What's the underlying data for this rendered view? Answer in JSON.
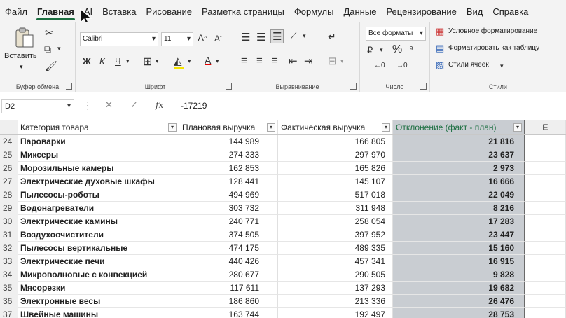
{
  "menu": {
    "tabs": [
      "Файл",
      "Главная",
      "AI",
      "Вставка",
      "Рисование",
      "Разметка страницы",
      "Формулы",
      "Данные",
      "Рецензирование",
      "Вид",
      "Справка"
    ],
    "active": "Главная"
  },
  "ribbon": {
    "clipboard": {
      "paste_label": "Вставить",
      "group_label": "Буфер обмена"
    },
    "font": {
      "font_name": "Calibri",
      "font_size": "11",
      "bold": "Ж",
      "italic": "К",
      "underline": "Ч",
      "group_label": "Шрифт"
    },
    "alignment": {
      "group_label": "Выравнивание"
    },
    "number": {
      "format": "Все форматы",
      "group_label": "Число"
    },
    "styles": {
      "conditional": "Условное форматирование",
      "format_table": "Форматировать как таблицу",
      "cell_styles": "Стили ячеек",
      "group_label": "Стили"
    }
  },
  "formula_bar": {
    "name_box": "D2",
    "formula": "-17219"
  },
  "grid": {
    "headers": [
      "Категория товара",
      "Плановая выручка",
      "Фактическая выручка",
      "Отклонение (факт - план)",
      "E"
    ],
    "rows": [
      {
        "n": "24",
        "cat": "Пароварки",
        "plan": "144 989",
        "fact": "166 805",
        "dev": "21 816"
      },
      {
        "n": "25",
        "cat": "Миксеры",
        "plan": "274 333",
        "fact": "297 970",
        "dev": "23 637"
      },
      {
        "n": "26",
        "cat": "Морозильные камеры",
        "plan": "162 853",
        "fact": "165 826",
        "dev": "2 973"
      },
      {
        "n": "27",
        "cat": "Электрические духовые шкафы",
        "plan": "128 441",
        "fact": "145 107",
        "dev": "16 666"
      },
      {
        "n": "28",
        "cat": "Пылесосы-роботы",
        "plan": "494 969",
        "fact": "517 018",
        "dev": "22 049"
      },
      {
        "n": "29",
        "cat": "Водонагреватели",
        "plan": "303 732",
        "fact": "311 948",
        "dev": "8 216"
      },
      {
        "n": "30",
        "cat": "Электрические камины",
        "plan": "240 771",
        "fact": "258 054",
        "dev": "17 283"
      },
      {
        "n": "31",
        "cat": "Воздухоочистители",
        "plan": "374 505",
        "fact": "397 952",
        "dev": "23 447"
      },
      {
        "n": "32",
        "cat": "Пылесосы вертикальные",
        "plan": "474 175",
        "fact": "489 335",
        "dev": "15 160"
      },
      {
        "n": "33",
        "cat": "Электрические печи",
        "plan": "440 426",
        "fact": "457 341",
        "dev": "16 915"
      },
      {
        "n": "34",
        "cat": "Микроволновые с конвекцией",
        "plan": "280 677",
        "fact": "290 505",
        "dev": "9 828"
      },
      {
        "n": "35",
        "cat": "Мясорезки",
        "plan": "117 611",
        "fact": "137 293",
        "dev": "19 682"
      },
      {
        "n": "36",
        "cat": "Электронные весы",
        "plan": "186 860",
        "fact": "213 336",
        "dev": "26 476"
      },
      {
        "n": "37",
        "cat": "Швейные машины",
        "plan": "163 744",
        "fact": "192 497",
        "dev": "28 753"
      }
    ]
  },
  "colors": {
    "accent": "#1d6f42",
    "selection": "#c9cdd2"
  }
}
